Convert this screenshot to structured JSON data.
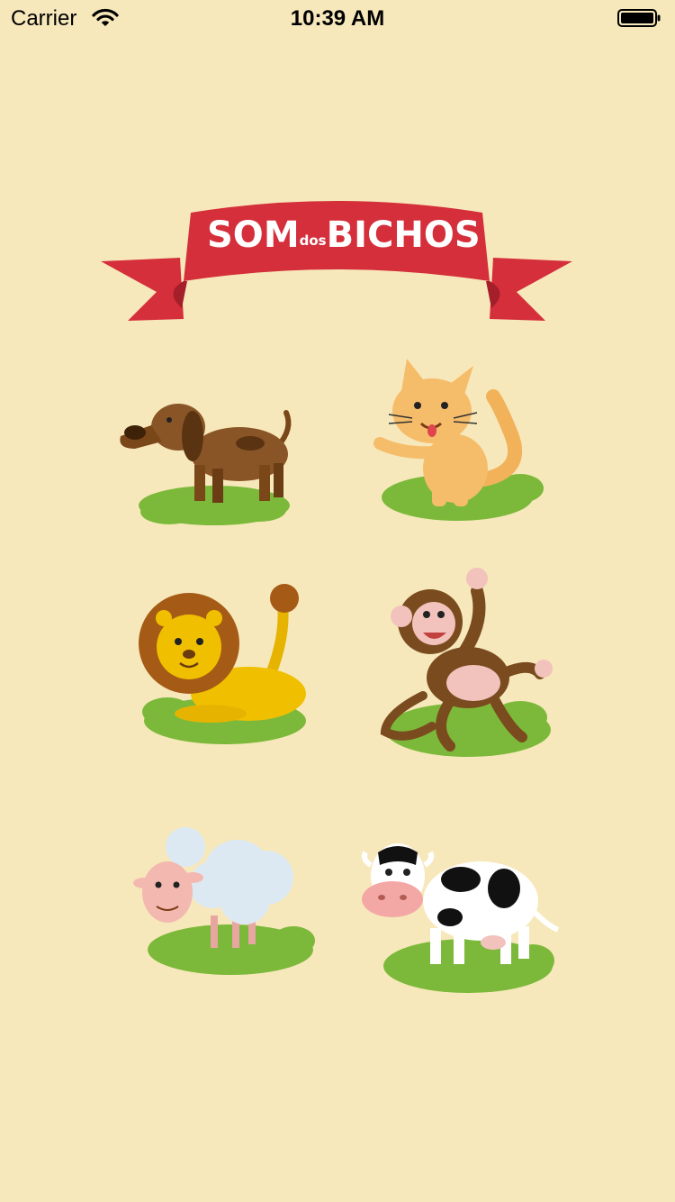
{
  "status_bar": {
    "carrier": "Carrier",
    "time": "10:39 AM",
    "wifi_icon": "wifi-icon",
    "battery_icon": "battery-icon"
  },
  "logo": {
    "word_som": "SOM",
    "word_dos": "dos",
    "word_bichos": "BICHOS",
    "ribbon_color": "#d42f3b",
    "text_color": "#ffffff"
  },
  "animals": [
    {
      "id": "dog",
      "icon": "dog-icon"
    },
    {
      "id": "cat",
      "icon": "cat-icon"
    },
    {
      "id": "lion",
      "icon": "lion-icon"
    },
    {
      "id": "monkey",
      "icon": "monkey-icon"
    },
    {
      "id": "sheep",
      "icon": "sheep-icon"
    },
    {
      "id": "cow",
      "icon": "cow-icon"
    }
  ],
  "colors": {
    "background": "#f7e8bb",
    "grass": "#7cb93a"
  }
}
